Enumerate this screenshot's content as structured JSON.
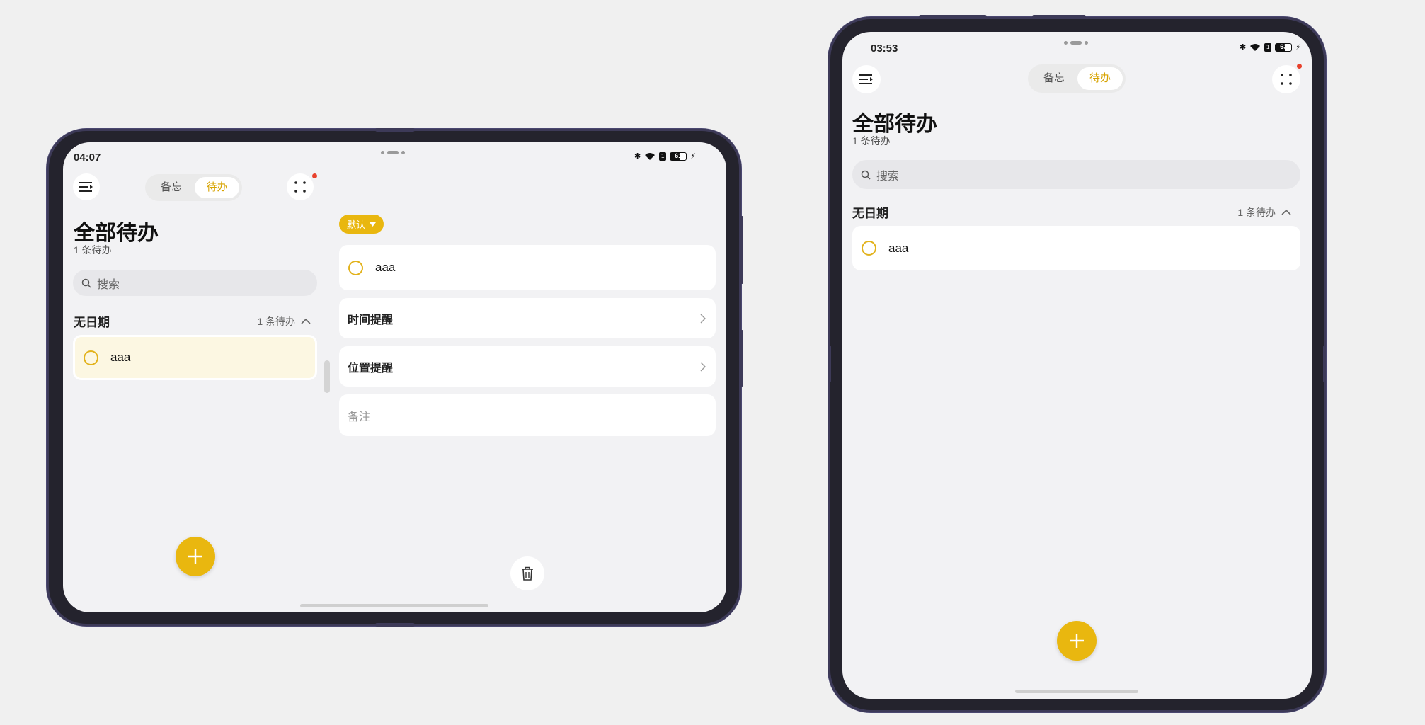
{
  "colors": {
    "accent": "#e9b70f",
    "accent_text": "#d7a300",
    "notification_dot": "#e8412c",
    "device_frame": "#24232d"
  },
  "landscape": {
    "status": {
      "time": "04:07",
      "battery": "61"
    },
    "left_pane": {
      "menu_icon": "menu-icon",
      "segment": {
        "tab1": "备忘",
        "tab2": "待办",
        "active": "待办"
      },
      "more_icon": "grid-dots-icon",
      "title": "全部待办",
      "subtitle": "1 条待办",
      "search_placeholder": "搜索",
      "group": {
        "title": "无日期",
        "count": "1 条待办"
      },
      "items": [
        {
          "text": "aaa",
          "selected": true
        }
      ],
      "fab_icon": "plus-icon"
    },
    "right_pane": {
      "sort_label": "默认",
      "todo_text": "aaa",
      "time_reminder": "时间提醒",
      "location_reminder": "位置提醒",
      "note_placeholder": "备注",
      "delete_icon": "trash-icon"
    }
  },
  "portrait": {
    "status": {
      "time": "03:53",
      "battery": "63"
    },
    "segment": {
      "tab1": "备忘",
      "tab2": "待办",
      "active": "待办"
    },
    "title": "全部待办",
    "subtitle": "1 条待办",
    "search_placeholder": "搜索",
    "group": {
      "title": "无日期",
      "count": "1 条待办"
    },
    "items": [
      {
        "text": "aaa"
      }
    ],
    "fab_icon": "plus-icon"
  }
}
